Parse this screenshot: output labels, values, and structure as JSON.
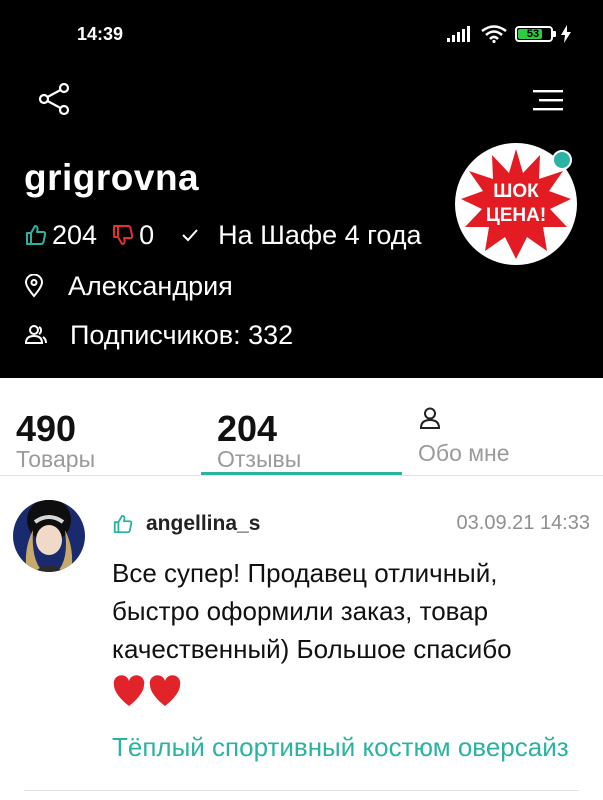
{
  "status_bar": {
    "time": "14:39",
    "battery": "53"
  },
  "header": {
    "share_icon": "share-icon",
    "menu_icon": "menu-icon"
  },
  "profile": {
    "username": "grigrovna",
    "likes": "204",
    "dislikes": "0",
    "member_since": "На Шафе 4 года",
    "city": "Александрия",
    "followers": "Подписчиков: 332",
    "avatar_text_line1": "ШОК",
    "avatar_text_line2": "ЦЕНА!",
    "online": true
  },
  "tabs": [
    {
      "count": "490",
      "label": "Товары"
    },
    {
      "count": "204",
      "label": "Отзывы",
      "active": true
    },
    {
      "icon": "person-icon",
      "label": "Обо мне"
    }
  ],
  "review": {
    "username": "angellina_s",
    "date": "03.09.21 14:33",
    "text": "Все супер! Продавец отличный, быстро оформили заказ, товар качественный) Большое спасибо",
    "hearts": "❤️❤️",
    "product": "Тёплый спортивный костюм оверсайз"
  },
  "colors": {
    "accent": "#2bb3a2",
    "dislike": "#e5302b",
    "header_bg": "#000000",
    "logo_red": "#e31b23"
  }
}
